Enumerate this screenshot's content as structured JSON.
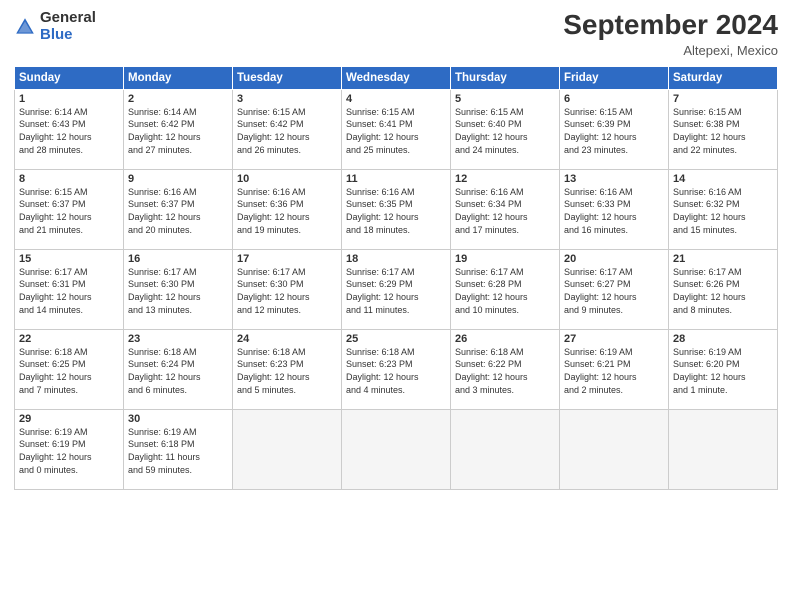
{
  "header": {
    "logo_general": "General",
    "logo_blue": "Blue",
    "month_title": "September 2024",
    "location": "Altepexi, Mexico"
  },
  "days_of_week": [
    "Sunday",
    "Monday",
    "Tuesday",
    "Wednesday",
    "Thursday",
    "Friday",
    "Saturday"
  ],
  "weeks": [
    [
      {
        "num": "1",
        "info": "Sunrise: 6:14 AM\nSunset: 6:43 PM\nDaylight: 12 hours\nand 28 minutes."
      },
      {
        "num": "2",
        "info": "Sunrise: 6:14 AM\nSunset: 6:42 PM\nDaylight: 12 hours\nand 27 minutes."
      },
      {
        "num": "3",
        "info": "Sunrise: 6:15 AM\nSunset: 6:42 PM\nDaylight: 12 hours\nand 26 minutes."
      },
      {
        "num": "4",
        "info": "Sunrise: 6:15 AM\nSunset: 6:41 PM\nDaylight: 12 hours\nand 25 minutes."
      },
      {
        "num": "5",
        "info": "Sunrise: 6:15 AM\nSunset: 6:40 PM\nDaylight: 12 hours\nand 24 minutes."
      },
      {
        "num": "6",
        "info": "Sunrise: 6:15 AM\nSunset: 6:39 PM\nDaylight: 12 hours\nand 23 minutes."
      },
      {
        "num": "7",
        "info": "Sunrise: 6:15 AM\nSunset: 6:38 PM\nDaylight: 12 hours\nand 22 minutes."
      }
    ],
    [
      {
        "num": "8",
        "info": "Sunrise: 6:15 AM\nSunset: 6:37 PM\nDaylight: 12 hours\nand 21 minutes."
      },
      {
        "num": "9",
        "info": "Sunrise: 6:16 AM\nSunset: 6:37 PM\nDaylight: 12 hours\nand 20 minutes."
      },
      {
        "num": "10",
        "info": "Sunrise: 6:16 AM\nSunset: 6:36 PM\nDaylight: 12 hours\nand 19 minutes."
      },
      {
        "num": "11",
        "info": "Sunrise: 6:16 AM\nSunset: 6:35 PM\nDaylight: 12 hours\nand 18 minutes."
      },
      {
        "num": "12",
        "info": "Sunrise: 6:16 AM\nSunset: 6:34 PM\nDaylight: 12 hours\nand 17 minutes."
      },
      {
        "num": "13",
        "info": "Sunrise: 6:16 AM\nSunset: 6:33 PM\nDaylight: 12 hours\nand 16 minutes."
      },
      {
        "num": "14",
        "info": "Sunrise: 6:16 AM\nSunset: 6:32 PM\nDaylight: 12 hours\nand 15 minutes."
      }
    ],
    [
      {
        "num": "15",
        "info": "Sunrise: 6:17 AM\nSunset: 6:31 PM\nDaylight: 12 hours\nand 14 minutes."
      },
      {
        "num": "16",
        "info": "Sunrise: 6:17 AM\nSunset: 6:30 PM\nDaylight: 12 hours\nand 13 minutes."
      },
      {
        "num": "17",
        "info": "Sunrise: 6:17 AM\nSunset: 6:30 PM\nDaylight: 12 hours\nand 12 minutes."
      },
      {
        "num": "18",
        "info": "Sunrise: 6:17 AM\nSunset: 6:29 PM\nDaylight: 12 hours\nand 11 minutes."
      },
      {
        "num": "19",
        "info": "Sunrise: 6:17 AM\nSunset: 6:28 PM\nDaylight: 12 hours\nand 10 minutes."
      },
      {
        "num": "20",
        "info": "Sunrise: 6:17 AM\nSunset: 6:27 PM\nDaylight: 12 hours\nand 9 minutes."
      },
      {
        "num": "21",
        "info": "Sunrise: 6:17 AM\nSunset: 6:26 PM\nDaylight: 12 hours\nand 8 minutes."
      }
    ],
    [
      {
        "num": "22",
        "info": "Sunrise: 6:18 AM\nSunset: 6:25 PM\nDaylight: 12 hours\nand 7 minutes."
      },
      {
        "num": "23",
        "info": "Sunrise: 6:18 AM\nSunset: 6:24 PM\nDaylight: 12 hours\nand 6 minutes."
      },
      {
        "num": "24",
        "info": "Sunrise: 6:18 AM\nSunset: 6:23 PM\nDaylight: 12 hours\nand 5 minutes."
      },
      {
        "num": "25",
        "info": "Sunrise: 6:18 AM\nSunset: 6:23 PM\nDaylight: 12 hours\nand 4 minutes."
      },
      {
        "num": "26",
        "info": "Sunrise: 6:18 AM\nSunset: 6:22 PM\nDaylight: 12 hours\nand 3 minutes."
      },
      {
        "num": "27",
        "info": "Sunrise: 6:19 AM\nSunset: 6:21 PM\nDaylight: 12 hours\nand 2 minutes."
      },
      {
        "num": "28",
        "info": "Sunrise: 6:19 AM\nSunset: 6:20 PM\nDaylight: 12 hours\nand 1 minute."
      }
    ],
    [
      {
        "num": "29",
        "info": "Sunrise: 6:19 AM\nSunset: 6:19 PM\nDaylight: 12 hours\nand 0 minutes."
      },
      {
        "num": "30",
        "info": "Sunrise: 6:19 AM\nSunset: 6:18 PM\nDaylight: 11 hours\nand 59 minutes."
      },
      {
        "num": "",
        "info": ""
      },
      {
        "num": "",
        "info": ""
      },
      {
        "num": "",
        "info": ""
      },
      {
        "num": "",
        "info": ""
      },
      {
        "num": "",
        "info": ""
      }
    ]
  ]
}
